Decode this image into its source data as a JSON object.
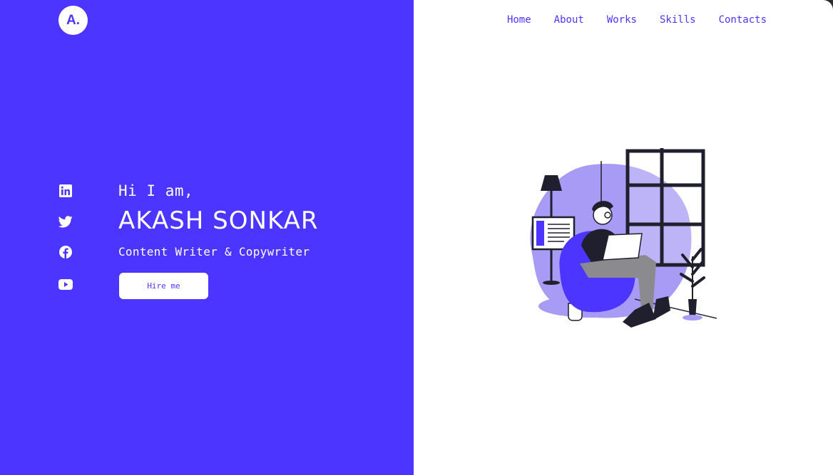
{
  "brand": {
    "logo_text": "A."
  },
  "nav": {
    "items": [
      {
        "label": "Home"
      },
      {
        "label": "About"
      },
      {
        "label": "Works"
      },
      {
        "label": "Skills"
      },
      {
        "label": "Contacts"
      }
    ]
  },
  "social": [
    {
      "icon": "linkedin-icon"
    },
    {
      "icon": "twitter-icon"
    },
    {
      "icon": "facebook-icon"
    },
    {
      "icon": "youtube-icon"
    }
  ],
  "hero": {
    "greeting": "Hi I am,",
    "name": "AKASH SONKAR",
    "role": "Content Writer & Copywriter",
    "cta_label": "Hire me"
  },
  "colors": {
    "accent": "#4c35ff",
    "accent_light": "#a79bf5",
    "background": "#ffffff"
  },
  "illustration": {
    "icon": "person-with-laptop-illustration"
  }
}
